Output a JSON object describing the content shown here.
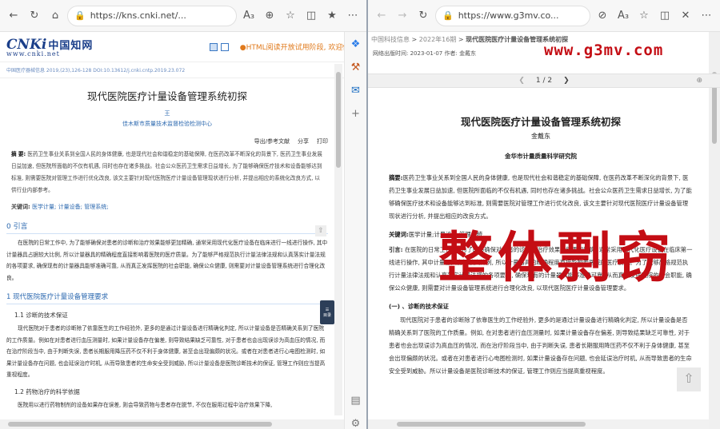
{
  "left_browser": {
    "url": "https://kns.cnki.net/...",
    "logo_text": "CNKi",
    "logo_cn": "中国知网",
    "logo_domain": "www.cnki.net",
    "html_note": "●HTML阅读开放试用阶段, 欢迎体验!",
    "meta_line": "中国医疗器械信息 2019,(23),126-128 DOI:10.13612/j.cnki.cntp.2019.23.072",
    "article": {
      "title": "现代医院医疗计量设备管理系统初探",
      "author": "王",
      "org": "佳木斯市质量技术监督检验检测中心",
      "tools": [
        "导出/参考文献",
        "分享",
        "打印"
      ],
      "abstract_label": "摘  要:",
      "abstract": "医药卫生事业关系到全国人民的身体健康, 也是现代社会和谐稳定的基础保障, 在医药改革不断深化的背景下, 医药卫生事业发展日益加速, 但医院所面临的不仅有机遇, 同时也存在诸多挑战。社会公众医药卫生需求日益增长, 为了能够确保医疗技术和设备能够达到标准, 则需要医院对管理工作进行优化改良, 该文主要针对现代医院医疗计量设备管理现状进行分析, 并提出相应的系统化改良方式, 以供行业内部参考。",
      "keywords_label": "关键词:",
      "keywords": "医学计量; 计量设备; 管理系统;",
      "sec0": "0 引言",
      "intro": "在医院的日常工作中, 为了能够确保对患者的诊断和治疗效果能够更加精确, 通常采用现代化医疗设备在临床进行一线进行操作, 其中计量器具占据较大比例, 所以计量器具的精确程度直接影响着医院的医疗质量。为了能够严格规范执行计量法律法规和认真落实计量法规的各项要求, 确保现有的计量器具能够准确可靠, 从而真正发挥医院的社会职能, 确保公众健康, 则需要对计量设备管理系统进行合理化改良。",
      "sec1": "1 现代医院医疗计量设备管理要求",
      "sec11": "1.1 诊断的技术保证",
      "p11": "现代医院对于患者的诊断除了依靠医生的工作经验外, 更多的是通过计量设备进行精确化判定, 所以计量设备是否精确关系到了医院的工作质量。例如在对患者进行血压测量时, 如果计量设备存在偏差, 则导致结果缺乏可靠性, 对于患者也会出现误诊为高血压的情况, 而在治疗阶段当中, 由于判断失误, 患者长期服用降压药不仅不利于身体健康, 甚至会出现偏颇的状况。或者在对患者进行心电图检测时, 如果计量设备存在问题, 也会延误治疗时机, 从而导致患者的生命安全受到威胁, 所以计量设备是医院诊断技术的保证, 管理工作则应当提高重视程度。",
      "sec12": "1.2 药物治疗的科学依据",
      "p12": "医院用以进行药物制剂的设备如果存在误差, 则会导致药物与患者存在脱节, 不仅在服用过程中治疗效果下降,"
    },
    "catalog_label": "目录"
  },
  "right_browser": {
    "url": "https://www.g3mv.co...",
    "breadcrumb": [
      "中国科技信息",
      "2022年16期",
      "现代医院医疗计量设备管理系统初探"
    ],
    "pubinfo": "网络出版时间: 2023-01-07   作者: 金戴东",
    "watermark": "www.g3mv.com",
    "page_indicator": "1 / 2",
    "article": {
      "title": "现代医院医疗计量设备管理系统初探",
      "author": "金戴东",
      "org": "金华市计量质量科学研究院",
      "abstract_label": "摘要:",
      "abstract": "医药卫生事业关系到全国人民的身体健康, 也是现代社会和谐稳定的基础保障, 在医药改革不断深化的背景下, 医药卫生事业发展日益加速, 但医院所面临的不仅有机遇, 同时也存在诸多挑战。社会公众医药卫生需求日益增长, 为了能够确保医疗技术和设备能够达到标准, 则需要医院对管理工作进行优化改良, 该文主要针对现代医院医疗计量设备管理现状进行分析, 并提出相应的改良方式。",
      "keywords_label": "关键词:",
      "keywords": "医学计量;计量设备;管理系统",
      "intro_label": "引言:",
      "intro": "在医院的日常工作中, 为了能够确保对患者的诊断和治疗效果能够更加精确, 通常采用现代化医疗设备在临床第一线进行操作, 其中计量器具占据较大比例, 所以计量器具的精确程度直接影响着医院的医疗质量。为了能够严格规范执行计量法律法规和认真落实计量法规的各项要求, 确保现有的计量器具能够准确可靠, 从而真正发挥医院的社会职能, 确保公众健康, 则需要对计量设备管理系统进行合理化改良, 以现代医院医疗计量设备管理要求。",
      "h1": "(一) 、诊断的技术保证",
      "p1": "现代医院对于患者的诊断除了依靠医生的工作经验外, 更多的是通过计量设备进行精确化判定, 所以计量设备是否精确关系到了医院的工作质量。例如, 在对患者进行血压测量时, 如果计量设备存在偏差, 则导致结果缺乏可靠性, 对于患者也会出现误诊为高血压的情况, 而在治疗阶段当中, 由于判断失误, 患者长期服用降压药不仅不利于身体健康, 甚至会出现偏颇的状况。或者在对患者进行心电图检测时, 如果计量设备存在问题, 也会延误治疗时机, 从而导致患者的生命安全受到威胁。所以计量设备是医院诊断技术的保证, 管理工作则应当提高重视程度。"
    },
    "stamp": "整体剽窃"
  }
}
